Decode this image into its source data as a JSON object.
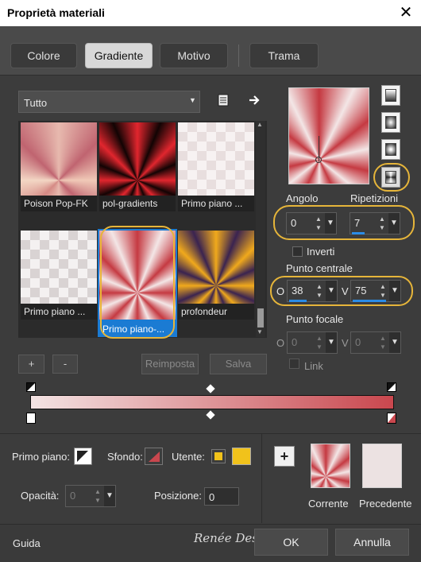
{
  "window": {
    "title": "Proprietà materiali",
    "close_glyph": "✕"
  },
  "tabs": [
    {
      "label": "Colore",
      "active": false
    },
    {
      "label": "Gradiente",
      "active": true
    },
    {
      "label": "Motivo",
      "active": false
    },
    {
      "label": "Trama",
      "active": false
    }
  ],
  "library": {
    "category": "Tutto",
    "thumbnails": [
      {
        "label": "Poison Pop-FK",
        "selected": false
      },
      {
        "label": "pol-gradients",
        "selected": false
      },
      {
        "label": "Primo piano ...",
        "selected": false
      },
      {
        "label": "Primo piano ...",
        "selected": false
      },
      {
        "label": "Primo piano-...",
        "selected": true
      },
      {
        "label": "profondeur",
        "selected": false
      }
    ],
    "add_label": "+",
    "remove_label": "-",
    "reset_label": "Reimposta",
    "save_label": "Salva"
  },
  "gradient": {
    "colors": {
      "left": "#f3e3e3",
      "right": "#c9474e"
    }
  },
  "properties": {
    "angle_label": "Angolo",
    "angle_value": "0",
    "repeats_label": "Ripetizioni",
    "repeats_value": "7",
    "invert_label": "Inverti",
    "center_label": "Punto centrale",
    "center_h_label": "O",
    "center_h_value": "38",
    "center_v_label": "V",
    "center_v_value": "75",
    "focal_label": "Punto focale",
    "focal_h_label": "O",
    "focal_h_value": "0",
    "focal_v_label": "V",
    "focal_v_value": "0",
    "link_label": "Link"
  },
  "stops": {
    "foreground_label": "Primo piano:",
    "background_label": "Sfondo:",
    "user_label": "Utente:",
    "user_color": "#f1c21b",
    "opacity_label": "Opacità:",
    "opacity_value": "0",
    "position_label": "Posizione:",
    "position_value": "0"
  },
  "compare": {
    "add_label": "+",
    "current_label": "Corrente",
    "previous_label": "Precedente",
    "previous_color": "#ece2e2"
  },
  "footer": {
    "help_label": "Guida",
    "watermark": "Renée Design",
    "ok_label": "OK",
    "cancel_label": "Annulla"
  }
}
